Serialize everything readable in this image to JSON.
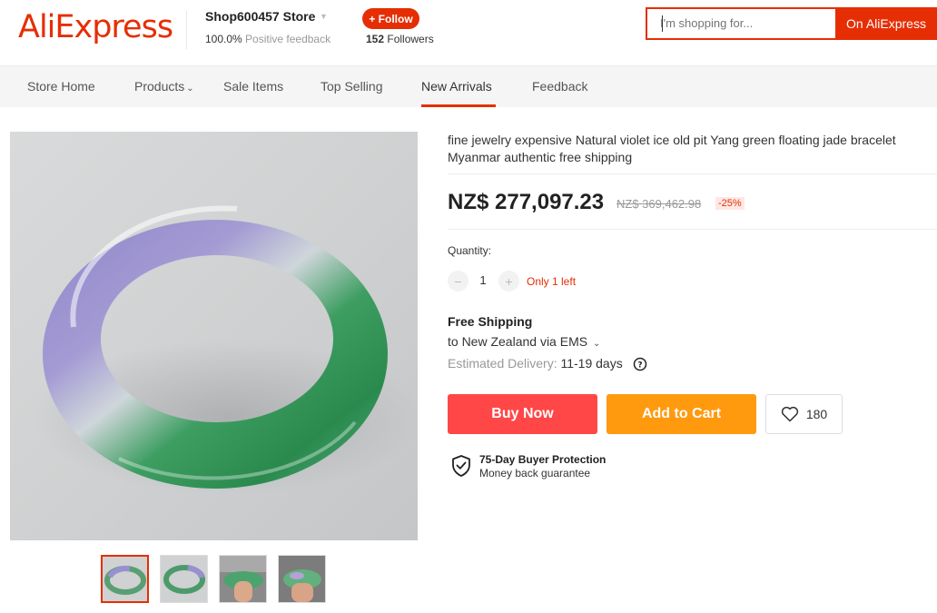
{
  "header": {
    "logo": "AliExpress",
    "store_name": "Shop600457 Store",
    "feedback_percent": "100.0%",
    "feedback_label": "Positive feedback",
    "follow_label": "+ Follow",
    "followers_count": "152",
    "followers_label": "Followers",
    "search_placeholder": "I'm shopping for...",
    "search_button": "On AliExpress"
  },
  "nav": {
    "items": [
      "Store Home",
      "Products",
      "Sale Items",
      "Top Selling",
      "New Arrivals",
      "Feedback"
    ],
    "active": "New Arrivals"
  },
  "product": {
    "title": "fine jewelry expensive Natural violet ice old pit Yang green floating jade bracelet Myanmar authentic free shipping",
    "price": "NZ$ 277,097.23",
    "original_price": "NZ$ 369,462.98",
    "discount": "-25%",
    "quantity_label": "Quantity:",
    "quantity_value": "1",
    "stock_note": "Only 1 left",
    "shipping_title": "Free Shipping",
    "shipping_dest": "to New Zealand via EMS",
    "delivery_label": "Estimated Delivery:",
    "delivery_days": "11-19 days",
    "buy_now": "Buy Now",
    "add_to_cart": "Add to Cart",
    "wishlist_count": "180",
    "protection_title": "75-Day Buyer Protection",
    "protection_sub": "Money back guarantee"
  },
  "colors": {
    "brand": "#e62e04",
    "buy_now": "#ff4747",
    "add_to_cart": "#ff9a0e"
  },
  "icons": {
    "qty_minus": "minus-icon",
    "qty_plus": "plus-icon",
    "help": "help-circle-icon",
    "wishlist": "heart-icon",
    "protection": "shield-check-icon"
  }
}
